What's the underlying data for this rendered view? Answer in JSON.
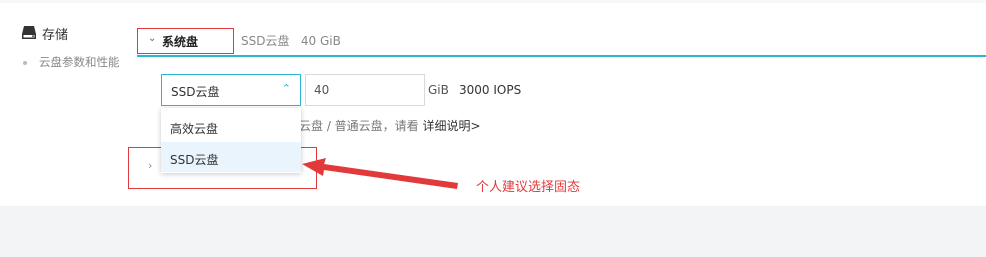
{
  "section": {
    "icon": "hdd-icon",
    "title": "存储",
    "subtitle": "云盘参数和性能"
  },
  "system_disk": {
    "label": "系统盘",
    "summary": "SSD云盘   40 GiB"
  },
  "disk_type_select": {
    "value": "SSD云盘",
    "options": [
      "高效云盘",
      "SSD云盘"
    ],
    "selected": "SSD云盘"
  },
  "size_input": {
    "value": "40"
  },
  "unit": "GiB",
  "iops": "3000 IOPS",
  "hint": {
    "text": "云盘 / 普通云盘，请看 ",
    "link": "详细说明>"
  },
  "annotation": {
    "text": "个人建议选择固态",
    "color": "#e23a3a"
  },
  "colors": {
    "accent": "#2bb6d6",
    "annotation": "#e23a3a"
  }
}
